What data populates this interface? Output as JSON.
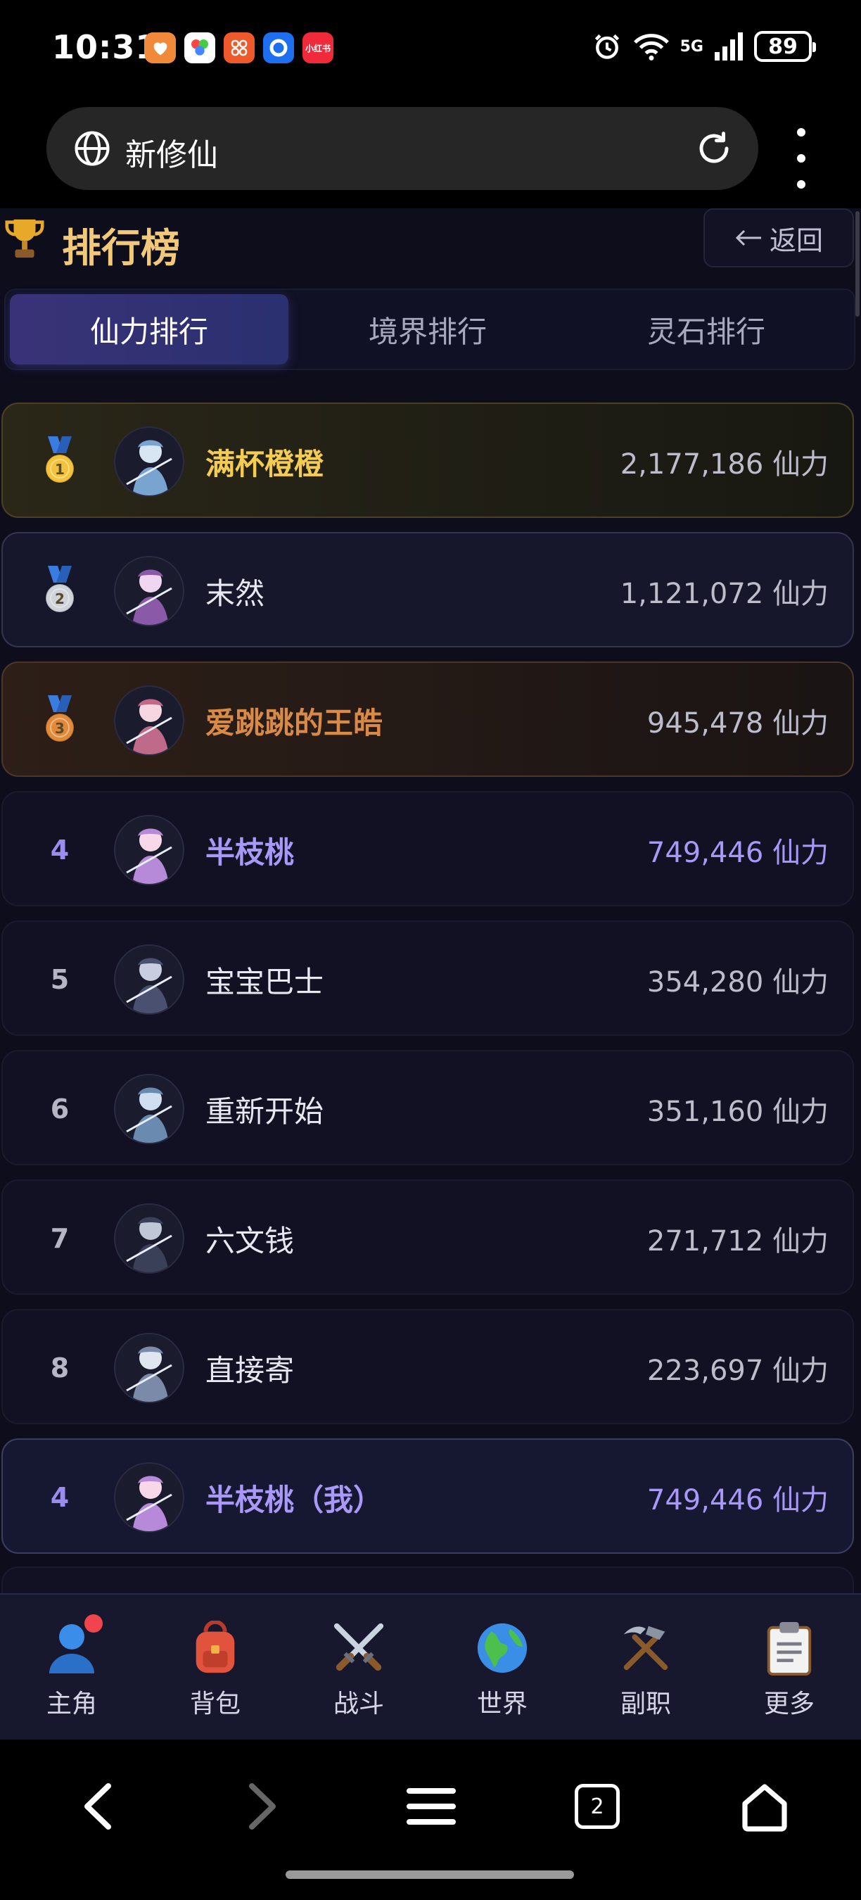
{
  "status_bar": {
    "time": "10:31",
    "app_icons": [
      {
        "icon": "heart-app-icon",
        "color": "#f08a3a"
      },
      {
        "icon": "multicolor-app-icon",
        "color": "#ffffff"
      },
      {
        "icon": "flower-app-icon",
        "color": "#f05a2a"
      },
      {
        "icon": "qq-browser-app-icon",
        "color": "#1e6ef0"
      },
      {
        "icon": "xiaohongshu-app-icon",
        "color": "#f02a3a",
        "text": "小红书"
      }
    ],
    "network_label": "5G",
    "battery": "89"
  },
  "browser": {
    "url_text": "新修仙"
  },
  "header": {
    "title": "排行榜",
    "back_label": "返回"
  },
  "tabs": [
    {
      "label": "仙力排行",
      "active": true
    },
    {
      "label": "境界排行",
      "active": false
    },
    {
      "label": "灵石排行",
      "active": false
    }
  ],
  "rankings": [
    {
      "rank": "1",
      "medal": "gold",
      "name": "满杯橙橙",
      "power": "2,177,186 仙力"
    },
    {
      "rank": "2",
      "medal": "silver",
      "name": "末然",
      "power": "1,121,072 仙力"
    },
    {
      "rank": "3",
      "medal": "bronze",
      "name": "爱跳跳的王皓",
      "power": "945,478 仙力"
    },
    {
      "rank": "4",
      "name": "半枝桃",
      "power": "749,446 仙力",
      "highlight": true
    },
    {
      "rank": "5",
      "name": "宝宝巴士",
      "power": "354,280 仙力"
    },
    {
      "rank": "6",
      "name": "重新开始",
      "power": "351,160 仙力"
    },
    {
      "rank": "7",
      "name": "六文钱",
      "power": "271,712 仙力"
    },
    {
      "rank": "8",
      "name": "直接寄",
      "power": "223,697 仙力"
    }
  ],
  "my_rank": {
    "rank": "4",
    "name": "半枝桃（我）",
    "power": "749,446 仙力"
  },
  "game_nav": [
    {
      "label": "主角",
      "icon": "person-icon",
      "badge": true
    },
    {
      "label": "背包",
      "icon": "backpack-icon"
    },
    {
      "label": "战斗",
      "icon": "crossed-swords-icon"
    },
    {
      "label": "世界",
      "icon": "globe-icon"
    },
    {
      "label": "副职",
      "icon": "hammer-pick-icon"
    },
    {
      "label": "更多",
      "icon": "clipboard-icon"
    }
  ],
  "system_nav": {
    "tab_count": "2"
  },
  "colors": {
    "gold_name": "#f4cc52",
    "bronze_name": "#d98a46",
    "purple_accent": "#a898f8",
    "title_gold": "#f2c879"
  }
}
